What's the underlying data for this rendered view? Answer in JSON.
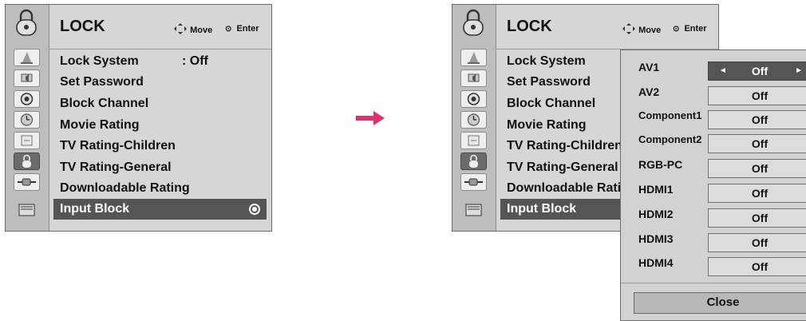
{
  "menu": {
    "title": "LOCK",
    "move_label": "Move",
    "enter_label": "Enter",
    "items": [
      {
        "label": "Lock System",
        "value": ": Off"
      },
      {
        "label": "Set Password"
      },
      {
        "label": "Block Channel"
      },
      {
        "label": "Movie Rating"
      },
      {
        "label": "TV Rating-Children"
      },
      {
        "label": "TV Rating-General"
      },
      {
        "label": "Downloadable Rating"
      },
      {
        "label": "Input Block",
        "selected": true
      }
    ],
    "icons": [
      "lock-icon",
      "picture-icon",
      "audio-icon",
      "time-icon",
      "option-icon",
      "lock-menu-icon",
      "input-icon",
      "media-icon"
    ]
  },
  "input_block": {
    "rows": [
      {
        "label": "AV1",
        "value": "Off",
        "active": true
      },
      {
        "label": "AV2",
        "value": "Off"
      },
      {
        "label": "Component1",
        "value": "Off"
      },
      {
        "label": "Component2",
        "value": "Off"
      },
      {
        "label": "RGB-PC",
        "value": "Off"
      },
      {
        "label": "HDMI1",
        "value": "Off"
      },
      {
        "label": "HDMI2",
        "value": "Off"
      },
      {
        "label": "HDMI3",
        "value": "Off"
      },
      {
        "label": "HDMI4",
        "value": "Off"
      }
    ],
    "close_label": "Close"
  },
  "colors": {
    "arrow": "#e0306a",
    "panel": "#d6d6d6",
    "selected": "#555555"
  }
}
